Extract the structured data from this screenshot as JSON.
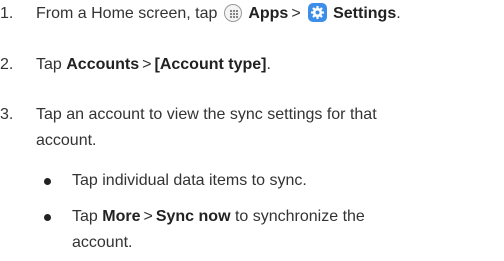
{
  "steps": [
    {
      "number": "1.",
      "parts": {
        "a": "From a Home screen, tap",
        "apps": "Apps",
        "sep": ">",
        "settings": "Settings",
        "end": "."
      }
    },
    {
      "number": "2.",
      "parts": {
        "a": "Tap",
        "accounts": "Accounts",
        "sep": ">",
        "type": "[Account type]",
        "end": "."
      }
    },
    {
      "number": "3.",
      "line1": "Tap an account to view the sync settings for that",
      "line2": "account."
    }
  ],
  "bullets": [
    {
      "text": "Tap individual data items to sync."
    },
    {
      "a": "Tap",
      "more": "More",
      "sep": ">",
      "sync": "Sync now",
      "b": "to synchronize the",
      "line2": "account."
    }
  ],
  "icons": {
    "apps": "apps-grid-icon",
    "settings": "settings-gear-icon"
  },
  "colors": {
    "text": "#333333",
    "settings_icon_bg": "#3d8ee8"
  }
}
